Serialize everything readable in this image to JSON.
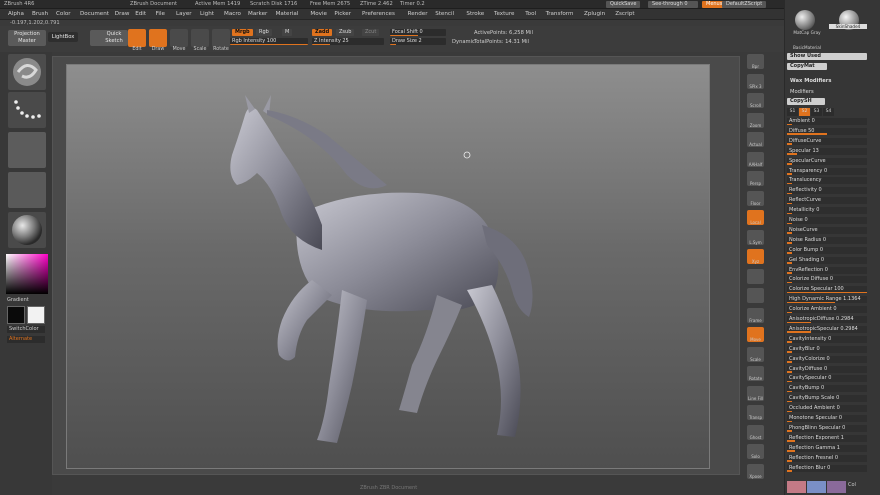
{
  "titlebar": {
    "app": "ZBrush 4R6",
    "doc": "ZBrush Document",
    "active_mem": "Active Mem 1419",
    "scratch_disk": "Scratch Disk 1716",
    "free_mem": "Free Mem 2675",
    "ztime": "ZTime 2.462",
    "timers": "Timer 0.2",
    "quicksave": "QuickSave",
    "see_through": "See-through 0",
    "menus": "Menus",
    "default_script": "DefaultZScript"
  },
  "menubar": {
    "items": [
      "Alpha",
      "Brush",
      "Color",
      "Document",
      "Draw",
      "Edit",
      "File",
      "Layer",
      "Light",
      "Macro",
      "Marker",
      "Material",
      "Movie",
      "Picker",
      "Preferences",
      "Render",
      "Stencil",
      "Stroke",
      "Texture",
      "Tool",
      "Transform",
      "Zplugin",
      "Zscript"
    ]
  },
  "coords": "-0.197,1.202,0.791",
  "shelf": {
    "projection_master": "Projection Master",
    "lightbox": "LightBox",
    "quick_sketch": "Quick Sketch",
    "tools": [
      "Edit",
      "Draw",
      "Move",
      "Scale",
      "Rotate"
    ],
    "mrgb": "Mrgb",
    "rgb": "Rgb",
    "m": "M",
    "rgb_intensity": "Rgb Intensity 100",
    "zadd": "Zadd",
    "zsub": "Zsub",
    "zcut": "Zcut",
    "z_intensity": "Z Intensity 25",
    "focal_shift": "Focal Shift 0",
    "draw_size": "Draw Size 2",
    "dynamic": "Dynamic",
    "active_points": "ActivePoints: 6,258 Mil",
    "total_points": "TotalPoints: 14.31 Mil"
  },
  "left": {
    "gradient": "Gradient",
    "switch_color": "SwitchColor",
    "alternate": "Alternate"
  },
  "right_tools": [
    "Bpr",
    "SPix 3",
    "Scroll",
    "Zoom",
    "Actual",
    "AAHalf",
    "Persp",
    "Floor",
    "Local",
    "L.Sym",
    "Xyz",
    "",
    "",
    "Frame",
    "Move",
    "Scale",
    "Rotate",
    "Line Fill",
    "Transp",
    "Ghost",
    "Solo",
    "Xpose"
  ],
  "palette": {
    "mat_label_1": "MatCap Gray",
    "mat_label_2": "SkinShade4",
    "mat_label_3": "BasicMaterial",
    "show_used": "Show Used",
    "copy_mat": "CopyMat",
    "wax_modifiers": "Wax Modifiers",
    "modifiers": "Modifiers",
    "copy_sh": "CopySH",
    "tabs": [
      "S1",
      "S2",
      "S3",
      "S4"
    ],
    "rows": [
      {
        "label": "Ambient 0",
        "fill": 0.0
      },
      {
        "label": "Diffuse 50",
        "fill": 0.5
      },
      {
        "label": "DiffuseCurve",
        "fill": 0.0
      },
      {
        "label": "Specular 13",
        "fill": 0.13
      },
      {
        "label": "SpecularCurve",
        "fill": 0.0
      },
      {
        "label": "Transparency 0",
        "fill": 0.0
      },
      {
        "label": "Translucency",
        "fill": 0.0
      },
      {
        "label": "Reflectivity 0",
        "fill": 0.0
      },
      {
        "label": "ReflectCurve",
        "fill": 0.0
      },
      {
        "label": "Metallicity 0",
        "fill": 0.0
      },
      {
        "label": "Noise 0",
        "fill": 0.0
      },
      {
        "label": "NoiseCurve",
        "fill": 0.0
      },
      {
        "label": "Noise Radius 0",
        "fill": 0.0
      },
      {
        "label": "Color Bump 0",
        "fill": 0.0
      },
      {
        "label": "Gel Shading 0",
        "fill": 0.0
      },
      {
        "label": "EnvReflection 0",
        "fill": 0.0
      },
      {
        "label": "Colorize Diffuse 0",
        "fill": 0.0
      },
      {
        "label": "Colorize Specular 100",
        "fill": 1.0
      },
      {
        "label": "High Dynamic Range 1.1364",
        "fill": 0.6
      },
      {
        "label": "Colorize Ambient 0",
        "fill": 0.0
      },
      {
        "label": "AnisotropicDiffuse 0.2984",
        "fill": 0.3
      },
      {
        "label": "AnisotropicSpecular 0.2984",
        "fill": 0.3
      },
      {
        "label": "CavityIntensity 0",
        "fill": 0.0
      },
      {
        "label": "CavityBlur 0",
        "fill": 0.0
      },
      {
        "label": "CavityColorize 0",
        "fill": 0.0
      },
      {
        "label": "CavityDiffuse 0",
        "fill": 0.0
      },
      {
        "label": "CavitySpecular 0",
        "fill": 0.0
      },
      {
        "label": "CavityBump 0",
        "fill": 0.0
      },
      {
        "label": "CavityBump Scale 0",
        "fill": 0.0
      },
      {
        "label": "Occluded Ambient 0",
        "fill": 0.0
      },
      {
        "label": "Monotone Specular 0",
        "fill": 0.0
      },
      {
        "label": "PhongBlinn Specular 0",
        "fill": 0.0
      },
      {
        "label": "Reflection Exponent 1",
        "fill": 0.1
      },
      {
        "label": "Reflection Gamma 1",
        "fill": 0.1
      },
      {
        "label": "Reflection Fresnel 0",
        "fill": 0.0
      },
      {
        "label": "Reflection Blur 0",
        "fill": 0.0
      }
    ],
    "colors": [
      "#c47a86",
      "#7a8fc6",
      "#8a6a9a",
      "#d7d7d7"
    ],
    "col": "Col"
  },
  "canvas_status": "ZBrush ZBR Document",
  "accent": "#e0731e"
}
